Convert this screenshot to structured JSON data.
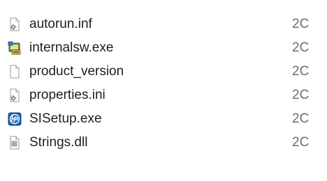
{
  "files": [
    {
      "name": "autorun.inf",
      "date": "2C",
      "icon": "settings-file-icon"
    },
    {
      "name": "internalsw.exe",
      "date": "2C",
      "icon": "installer-exe-icon"
    },
    {
      "name": "product_version",
      "date": "2C",
      "icon": "blank-file-icon"
    },
    {
      "name": "properties.ini",
      "date": "2C",
      "icon": "settings-file-icon"
    },
    {
      "name": "SISetup.exe",
      "date": "2C",
      "icon": "hp-setup-icon"
    },
    {
      "name": "Strings.dll",
      "date": "2C",
      "icon": "dll-file-icon"
    }
  ],
  "colors": {
    "text": "#1e1e1e",
    "date_text": "#6d6d6d",
    "hp_blue": "#1a63b8",
    "installer_green": "#4f7d2a"
  }
}
